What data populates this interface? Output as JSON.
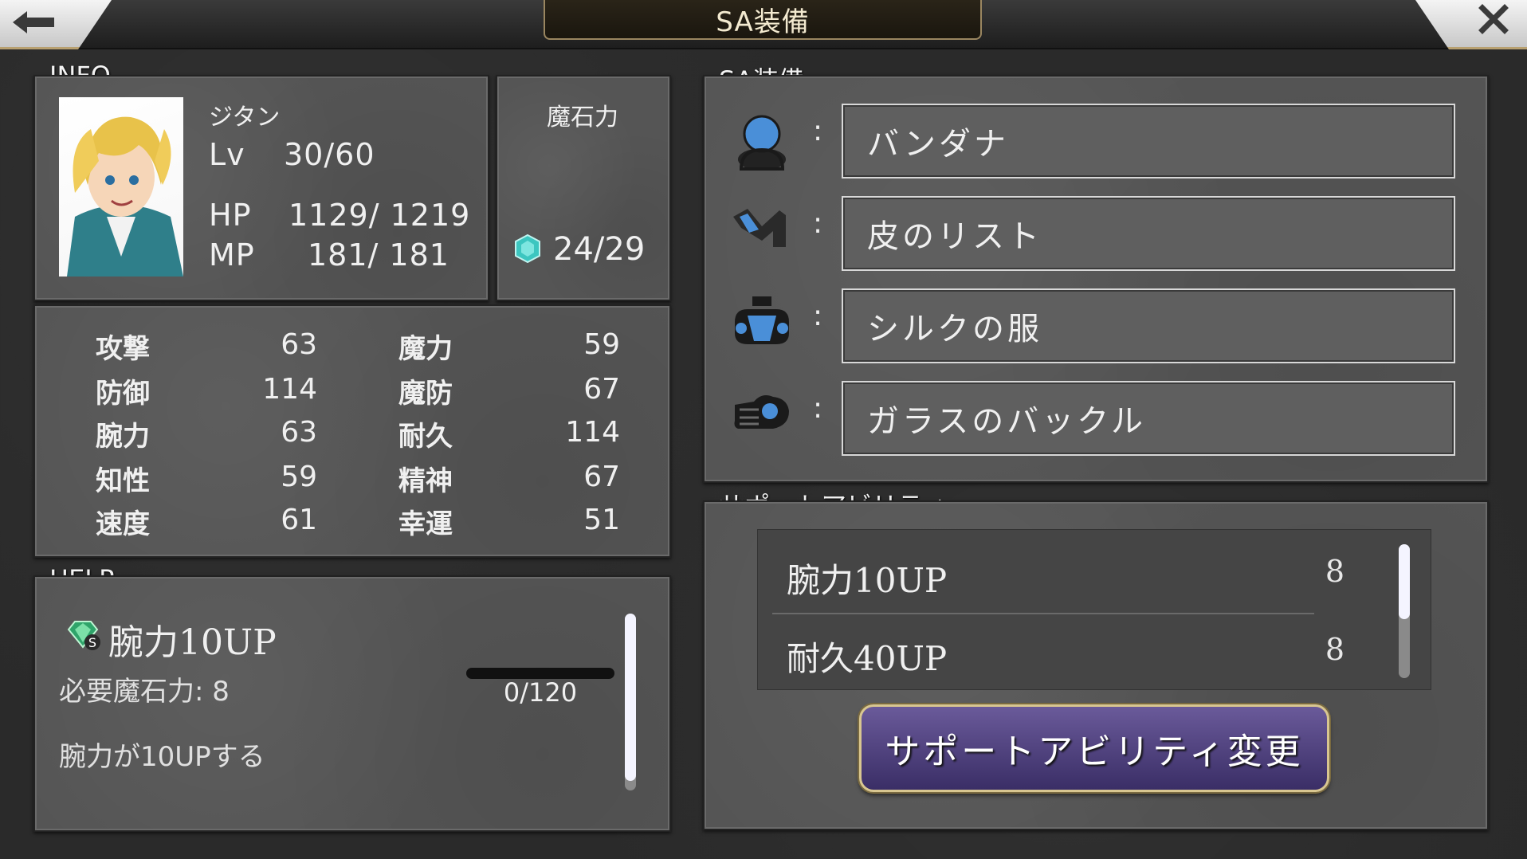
{
  "header": {
    "title": "SA装備",
    "back_icon": "left-arrow-icon",
    "close_icon": "close-icon"
  },
  "info": {
    "section_label": "INFO",
    "character_name": "ジタン",
    "level_label": "Lv",
    "level_value": "30/60",
    "hp_label": "HP",
    "hp_value": "1129/ 1219",
    "mp_label": "MP",
    "mp_value": "181/ 181",
    "mastone_label": "魔石力",
    "mastone_value": "24/29"
  },
  "stats": [
    {
      "label": "攻撃",
      "value": "63"
    },
    {
      "label": "防御",
      "value": "114"
    },
    {
      "label": "腕力",
      "value": "63"
    },
    {
      "label": "知性",
      "value": "59"
    },
    {
      "label": "速度",
      "value": "61"
    },
    {
      "label": "魔力",
      "value": "59"
    },
    {
      "label": "魔防",
      "value": "67"
    },
    {
      "label": "耐久",
      "value": "114"
    },
    {
      "label": "精神",
      "value": "67"
    },
    {
      "label": "幸運",
      "value": "51"
    }
  ],
  "help": {
    "section_label": "HELP",
    "ability_name": "腕力10UP",
    "cost_text": "必要魔石力: 8",
    "progress_text": "0/120",
    "progress_fraction": 0,
    "description": "腕力が10UPする"
  },
  "sa_equip": {
    "section_label": "SA装備",
    "items": [
      {
        "icon": "head-icon",
        "colon": ":",
        "name": "バンダナ"
      },
      {
        "icon": "arm-icon",
        "colon": ":",
        "name": "皮のリスト"
      },
      {
        "icon": "body-armor-icon",
        "colon": ":",
        "name": "シルクの服"
      },
      {
        "icon": "accessory-icon",
        "colon": ":",
        "name": "ガラスのバックル"
      }
    ]
  },
  "support": {
    "section_label": "サポートアビリティ",
    "items": [
      {
        "name": "腕力10UP",
        "cost": "8"
      },
      {
        "name": "耐久40UP",
        "cost": "8"
      }
    ],
    "change_button": "サポートアビリティ変更"
  },
  "colors": {
    "panel": "#555555",
    "button_purple": "#4d3f80",
    "gold_border": "#d8c690"
  }
}
